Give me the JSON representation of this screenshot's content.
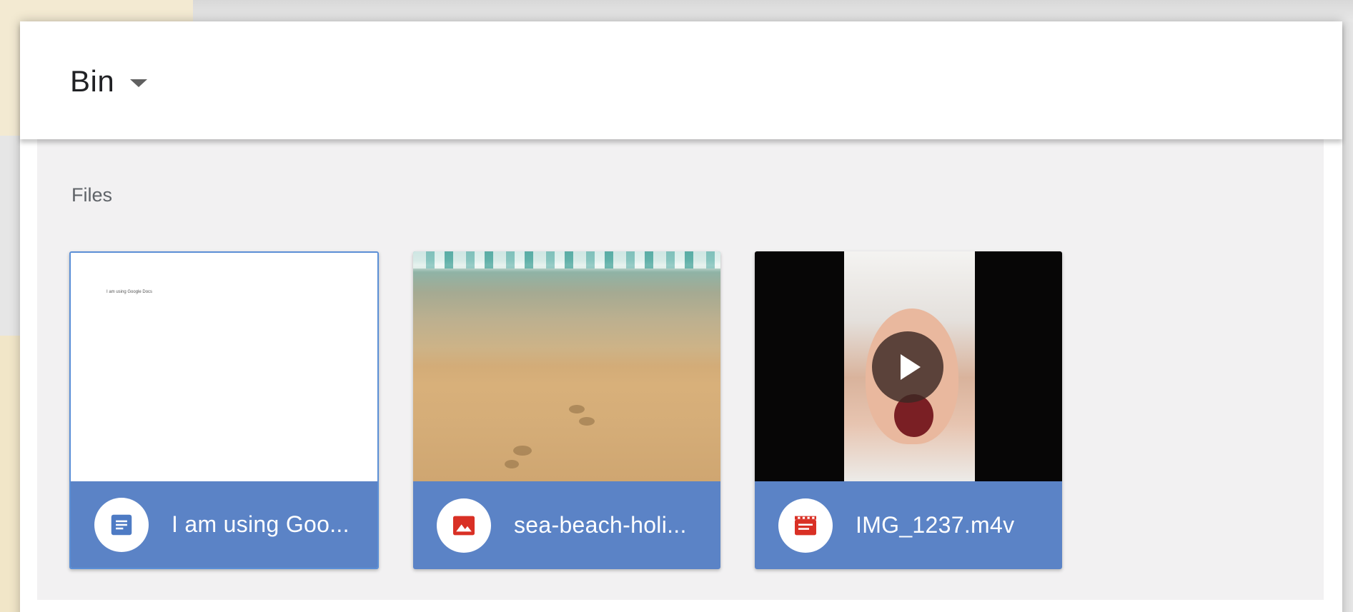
{
  "header": {
    "title": "Bin"
  },
  "files_section": {
    "label": "Files",
    "items": [
      {
        "name": "I am using Goo...",
        "type_icon": "doc-icon",
        "preview_text": "I am using Google Docs",
        "accent_color": "#4e7bc4"
      },
      {
        "name": "sea-beach-holi...",
        "type_icon": "image-icon",
        "accent_color": "#d93025"
      },
      {
        "name": "IMG_1237.m4v",
        "type_icon": "video-icon",
        "accent_color": "#d93025"
      }
    ]
  },
  "colors": {
    "card_footer": "#5b83c6",
    "content_bg": "#f2f1f2",
    "selected_border": "#5b8fd6"
  }
}
